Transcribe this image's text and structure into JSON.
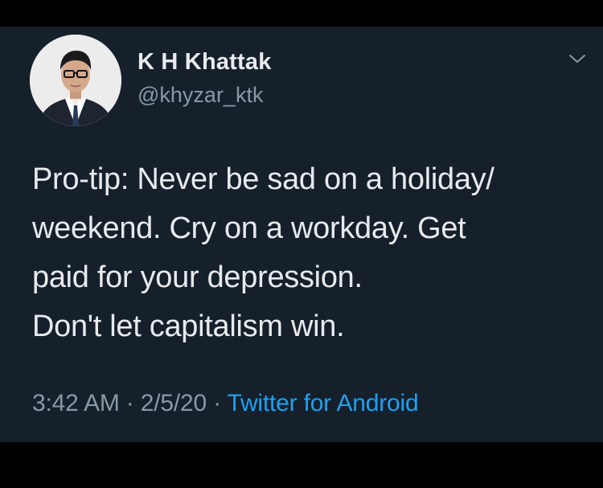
{
  "tweet": {
    "author": {
      "display_name": "K H Khattak",
      "handle": "@khyzar_ktk",
      "avatar_icon": "profile-photo"
    },
    "menu_icon": "chevron-down-icon",
    "text_lines": [
      "Pro-tip: Never be sad on a holiday/",
      "weekend. Cry on a workday. Get",
      "paid for your depression.",
      "Don't let capitalism win."
    ],
    "time": "3:42 AM",
    "separator_1": " · ",
    "date": "2/5/20",
    "separator_2": " · ",
    "source": "Twitter for Android"
  },
  "colors": {
    "background": "#15202b",
    "outer": "#000000",
    "text": "#e8eaed",
    "secondary": "#8899a6",
    "link": "#1da1f2"
  }
}
